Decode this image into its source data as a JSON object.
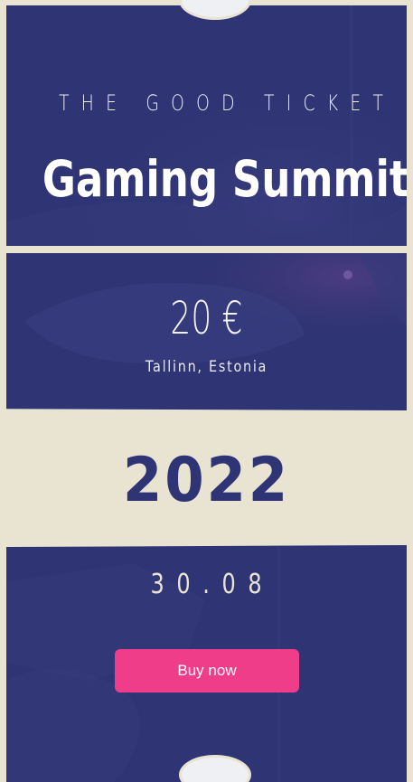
{
  "ticket": {
    "brand": "THE GOOD TICKET",
    "title": "Gaming Summit",
    "price": "20 €",
    "location": "Tallinn, Estonia",
    "year": "2022",
    "date": "30.08",
    "buy_label": "Buy now"
  },
  "colors": {
    "panel": "#2e3474",
    "paper": "#e9e3d2",
    "accent": "#f03d8a",
    "notch": "#eef0f3"
  }
}
